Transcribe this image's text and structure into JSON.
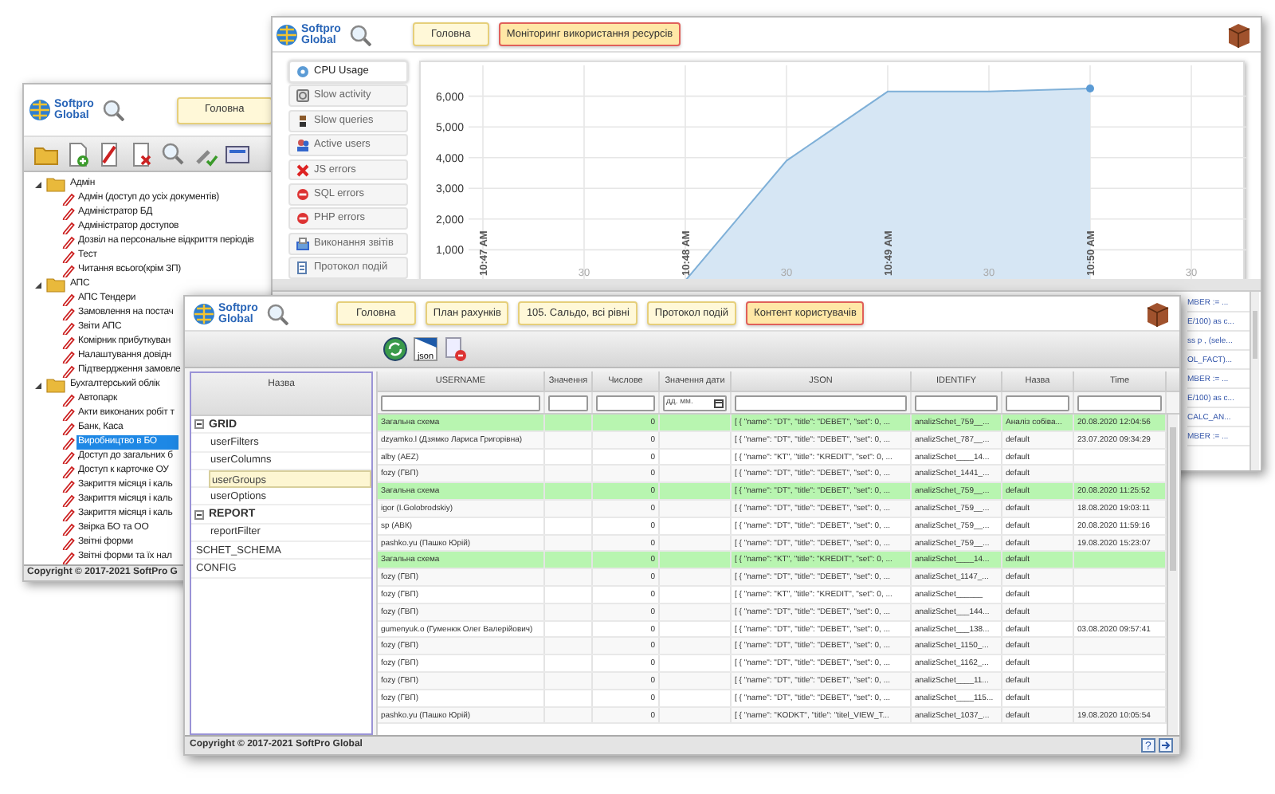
{
  "left_window": {
    "logo_lines": [
      "Softpro",
      "Global"
    ],
    "tabs": [
      {
        "label": "Головна",
        "selected": false
      }
    ],
    "tree": [
      {
        "label": "Адмін",
        "expanded": true,
        "selected": false,
        "children": [
          {
            "label": "Адмін (доступ до усіх документів)",
            "selected": false
          },
          {
            "label": "Адміністратор БД",
            "selected": false
          },
          {
            "label": "Адміністратор доступов",
            "selected": false
          },
          {
            "label": "Дозвіл на персональне відкриття періодів",
            "selected": false
          },
          {
            "label": "Тест",
            "selected": false
          },
          {
            "label": "Читання всього(крім ЗП)",
            "selected": false
          }
        ]
      },
      {
        "label": "АПС",
        "expanded": true,
        "selected": false,
        "children": [
          {
            "label": "АПС Тендери",
            "selected": false
          },
          {
            "label": "Замовлення на постач",
            "selected": false
          },
          {
            "label": "Звіти АПС",
            "selected": false
          },
          {
            "label": "Комірник прибуткуван",
            "selected": false
          },
          {
            "label": "Налаштування довідн",
            "selected": false
          },
          {
            "label": "Підтвердження замовле",
            "selected": false
          }
        ]
      },
      {
        "label": "Бухгалтерський облік",
        "expanded": true,
        "selected": false,
        "children": [
          {
            "label": "Автопарк",
            "selected": false
          },
          {
            "label": "Акти виконаних робіт т",
            "selected": false
          },
          {
            "label": "Банк, Каса",
            "selected": false
          },
          {
            "label": "Виробництво в БО",
            "selected": true
          },
          {
            "label": "Доступ до загальних б",
            "selected": false
          },
          {
            "label": "Доступ к карточке ОУ",
            "selected": false
          },
          {
            "label": "Закриття місяця і каль",
            "selected": false
          },
          {
            "label": "Закриття місяця і каль",
            "selected": false
          },
          {
            "label": "Закриття місяця і каль",
            "selected": false
          },
          {
            "label": "Звірка БО та ОО",
            "selected": false
          },
          {
            "label": "Звітні форми",
            "selected": false
          },
          {
            "label": "Звітні форми та їх нал",
            "selected": false
          }
        ]
      }
    ],
    "copyright": "Copyright © 2017-2021 SoftPro G"
  },
  "monitor_window": {
    "logo_lines": [
      "Softpro",
      "Global"
    ],
    "tabs": [
      {
        "label": "Головна",
        "selected": false
      },
      {
        "label": "Моніторинг використання ресурсів",
        "selected": true
      }
    ],
    "menu": [
      {
        "label": "CPU Usage",
        "selected": true
      },
      {
        "label": "Slow activity",
        "selected": false
      },
      {
        "label": "Slow queries",
        "selected": false
      },
      {
        "label": "Active users",
        "selected": false
      },
      {
        "label": "JS errors",
        "selected": false
      },
      {
        "label": "SQL errors",
        "selected": false
      },
      {
        "label": "PHP errors",
        "selected": false
      },
      {
        "label": "Виконання звітів",
        "selected": false
      },
      {
        "label": "Протокол подій",
        "selected": false
      }
    ],
    "chart_data": {
      "type": "area",
      "categories": [
        "10:47 AM",
        "30",
        "10:48 AM",
        "30",
        "10:49 AM",
        "30",
        "10:50 AM",
        "30"
      ],
      "series": [
        {
          "color": "#7fb0d8",
          "values": [
            null,
            null,
            0,
            3900,
            6150,
            6150,
            6250,
            null
          ]
        }
      ],
      "ylim": [
        0,
        7000
      ],
      "grid": true,
      "yticks": [
        {
          "value": 1000,
          "label": "1,000"
        },
        {
          "value": 2000,
          "label": "2,000"
        },
        {
          "value": 3000,
          "label": "3,000"
        },
        {
          "value": 4000,
          "label": "4,000"
        },
        {
          "value": 5000,
          "label": "5,000"
        },
        {
          "value": 6000,
          "label": "6,000"
        }
      ]
    },
    "query_column": [
      "MBER := ...",
      "E/100) as c...",
      "ss p , (sele...",
      "OL_FACT)...",
      "MBER := ...",
      "E/100) as c...",
      "CALC_AN...",
      "MBER := ..."
    ]
  },
  "content_window": {
    "logo_lines": [
      "Softpro",
      "Global"
    ],
    "tabs": [
      {
        "label": "Головна",
        "selected": false
      },
      {
        "label": "План рахунків",
        "selected": false
      },
      {
        "label": "105. Сальдо, всі рівні",
        "selected": false
      },
      {
        "label": "Протокол подій",
        "selected": false
      },
      {
        "label": "Контент користувачів",
        "selected": true
      }
    ],
    "tree_header": "Назва",
    "json_icon_text": "json",
    "help_icon_text": "?",
    "tree": [
      {
        "label": "GRID",
        "expanded": true,
        "selected": false,
        "children": [
          {
            "label": "userFilters",
            "selected": false
          },
          {
            "label": "userColumns",
            "selected": false
          },
          {
            "label": "userGroups",
            "selected": true
          },
          {
            "label": "userOptions",
            "selected": false
          }
        ]
      },
      {
        "label": "REPORT",
        "expanded": true,
        "selected": false,
        "children": [
          {
            "label": "reportFilter",
            "selected": false
          }
        ]
      },
      {
        "label": "SCHET_SCHEMA",
        "selected": false
      },
      {
        "label": "CONFIG",
        "selected": false
      }
    ],
    "table": {
      "columns": [
        {
          "label": "USERNAME",
          "kind": "text"
        },
        {
          "label": "Значення",
          "kind": "text"
        },
        {
          "label": "Числове",
          "kind": "text"
        },
        {
          "label": "Значення дати",
          "kind": "date",
          "placeholder": "дд. мм."
        },
        {
          "label": "JSON",
          "kind": "text"
        },
        {
          "label": "IDENTIFY",
          "kind": "text"
        },
        {
          "label": "Назва",
          "kind": "text"
        },
        {
          "label": "Time",
          "kind": "text"
        }
      ],
      "rows": [
        {
          "highlighted": true,
          "username": "Загальна схема",
          "number": "0",
          "json": "[ { \"name\": \"DT\", \"title\": \"DEBET\", \"set\": 0, ...",
          "identify": "analizSchet_759__...",
          "name": "Аналіз собіва...",
          "time": "20.08.2020 12:04:56"
        },
        {
          "highlighted": false,
          "username": "dzyamko.l (Дзямко Лариса Григорівна)",
          "number": "0",
          "json": "[ { \"name\": \"DT\", \"title\": \"DEBET\", \"set\": 0, ...",
          "identify": "analizSchet_787__...",
          "name": "default",
          "time": "23.07.2020 09:34:29"
        },
        {
          "highlighted": false,
          "username": "alby (AEZ)",
          "number": "0",
          "json": "[ { \"name\": \"KT\", \"title\": \"KREDIT\", \"set\": 0, ...",
          "identify": "analizSchet____14...",
          "name": "default"
        },
        {
          "highlighted": false,
          "username": "fozy (ГВП)",
          "number": "0",
          "json": "[ { \"name\": \"DT\", \"title\": \"DEBET\", \"set\": 0, ...",
          "identify": "analizSchet_1441_...",
          "name": "default"
        },
        {
          "highlighted": true,
          "username": "Загальна схема",
          "number": "0",
          "json": "[ { \"name\": \"DT\", \"title\": \"DEBET\", \"set\": 0, ...",
          "identify": "analizSchet_759__...",
          "name": "default",
          "time": "20.08.2020 11:25:52"
        },
        {
          "highlighted": false,
          "username": "igor (I.Golobrodskiy)",
          "number": "0",
          "json": "[ { \"name\": \"DT\", \"title\": \"DEBET\", \"set\": 0, ...",
          "identify": "analizSchet_759__...",
          "name": "default",
          "time": "18.08.2020 19:03:11"
        },
        {
          "highlighted": false,
          "username": "sp (АВК)",
          "number": "0",
          "json": "[ { \"name\": \"DT\", \"title\": \"DEBET\", \"set\": 0, ...",
          "identify": "analizSchet_759__...",
          "name": "default",
          "time": "20.08.2020 11:59:16"
        },
        {
          "highlighted": false,
          "username": "pashko.yu (Пашко Юрій)",
          "number": "0",
          "json": "[ { \"name\": \"DT\", \"title\": \"DEBET\", \"set\": 0, ...",
          "identify": "analizSchet_759__...",
          "name": "default",
          "time": "19.08.2020 15:23:07"
        },
        {
          "highlighted": true,
          "username": "Загальна схема",
          "number": "0",
          "json": "[ { \"name\": \"KT\", \"title\": \"KREDIT\", \"set\": 0, ...",
          "identify": "analizSchet____14...",
          "name": "default"
        },
        {
          "highlighted": false,
          "username": "fozy (ГВП)",
          "number": "0",
          "json": "[ { \"name\": \"DT\", \"title\": \"DEBET\", \"set\": 0, ...",
          "identify": "analizSchet_1147_...",
          "name": "default"
        },
        {
          "highlighted": false,
          "username": "fozy (ГВП)",
          "number": "0",
          "json": "[ { \"name\": \"KT\", \"title\": \"KREDIT\", \"set\": 0, ...",
          "identify": "analizSchet______",
          "name": "default"
        },
        {
          "highlighted": false,
          "username": "fozy (ГВП)",
          "number": "0",
          "json": "[ { \"name\": \"DT\", \"title\": \"DEBET\", \"set\": 0, ...",
          "identify": "analizSchet___144...",
          "name": "default"
        },
        {
          "highlighted": false,
          "username": "gumenyuk.o (Гуменюк Олег Валерійович)",
          "number": "0",
          "json": "[ { \"name\": \"DT\", \"title\": \"DEBET\", \"set\": 0, ...",
          "identify": "analizSchet___138...",
          "name": "default",
          "time": "03.08.2020 09:57:41"
        },
        {
          "highlighted": false,
          "username": "fozy (ГВП)",
          "number": "0",
          "json": "[ { \"name\": \"DT\", \"title\": \"DEBET\", \"set\": 0, ...",
          "identify": "analizSchet_1150_...",
          "name": "default"
        },
        {
          "highlighted": false,
          "username": "fozy (ГВП)",
          "number": "0",
          "json": "[ { \"name\": \"DT\", \"title\": \"DEBET\", \"set\": 0, ...",
          "identify": "analizSchet_1162_...",
          "name": "default"
        },
        {
          "highlighted": false,
          "username": "fozy (ГВП)",
          "number": "0",
          "json": "[ { \"name\": \"DT\", \"title\": \"DEBET\", \"set\": 0, ...",
          "identify": "analizSchet____11...",
          "name": "default"
        },
        {
          "highlighted": false,
          "username": "fozy (ГВП)",
          "number": "0",
          "json": "[ { \"name\": \"DT\", \"title\": \"DEBET\", \"set\": 0, ...",
          "identify": "analizSchet____115...",
          "name": "default"
        },
        {
          "highlighted": false,
          "username": "pashko.yu (Пашко Юрій)",
          "number": "0",
          "json": "[ { \"name\": \"KODKT\", \"title\": \"titel_VIEW_T...",
          "identify": "analizSchet_1037_...",
          "name": "default",
          "time": "19.08.2020 10:05:54"
        }
      ]
    },
    "copyright": "Copyright © 2017-2021 SoftPro Global"
  }
}
